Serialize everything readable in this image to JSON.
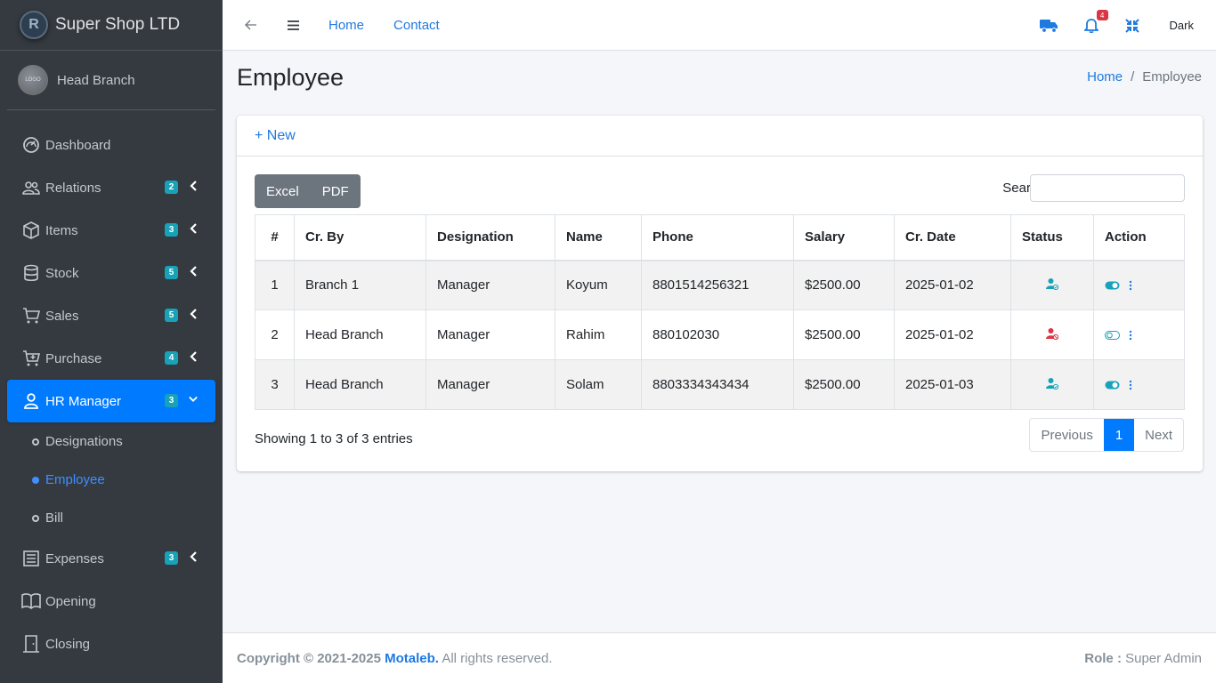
{
  "brand": {
    "name": "Super Shop LTD",
    "logo_letter": "R"
  },
  "user": {
    "name": "Head Branch",
    "avatar_text": "LOGO"
  },
  "sidebar": {
    "items": [
      {
        "label": "Dashboard",
        "icon": "gauge-icon"
      },
      {
        "label": "Relations",
        "icon": "users-icon",
        "badge": "2"
      },
      {
        "label": "Items",
        "icon": "box-icon",
        "badge": "3"
      },
      {
        "label": "Stock",
        "icon": "database-icon",
        "badge": "5"
      },
      {
        "label": "Sales",
        "icon": "cart-icon",
        "badge": "5"
      },
      {
        "label": "Purchase",
        "icon": "cart-plus-icon",
        "badge": "4"
      },
      {
        "label": "HR Manager",
        "icon": "user-icon",
        "badge": "3"
      }
    ],
    "sub_items": [
      "Designations",
      "Employee",
      "Bill"
    ],
    "items_after": [
      {
        "label": "Expenses",
        "icon": "list-icon",
        "badge": "3"
      },
      {
        "label": "Opening",
        "icon": "book-icon"
      },
      {
        "label": "Closing",
        "icon": "door-icon"
      }
    ]
  },
  "topbar": {
    "home": "Home",
    "contact": "Contact",
    "notif_count": "4",
    "theme": "Dark"
  },
  "page": {
    "title": "Employee",
    "breadcrumb_home": "Home",
    "breadcrumb_current": "Employee"
  },
  "card": {
    "new_label": "+ New",
    "excel": "Excel",
    "pdf": "PDF",
    "search_label": "Search:"
  },
  "table": {
    "headers": [
      "#",
      "Cr. By",
      "Designation",
      "Name",
      "Phone",
      "Salary",
      "Cr. Date",
      "Status",
      "Action"
    ],
    "rows": [
      {
        "no": "1",
        "cr_by": "Branch 1",
        "designation": "Manager",
        "name": "Koyum",
        "phone": "8801514256321",
        "salary": "$2500.00",
        "date": "2025-01-02",
        "status": "active",
        "toggle": "on"
      },
      {
        "no": "2",
        "cr_by": "Head Branch",
        "designation": "Manager",
        "name": "Rahim",
        "phone": "880102030",
        "salary": "$2500.00",
        "date": "2025-01-02",
        "status": "inactive",
        "toggle": "off"
      },
      {
        "no": "3",
        "cr_by": "Head Branch",
        "designation": "Manager",
        "name": "Solam",
        "phone": "8803334343434",
        "salary": "$2500.00",
        "date": "2025-01-03",
        "status": "active",
        "toggle": "on"
      }
    ]
  },
  "pagination": {
    "info": "Showing 1 to 3 of 3 entries",
    "previous": "Previous",
    "current": "1",
    "next": "Next"
  },
  "footer": {
    "copyright": "Copyright © 2021-2025",
    "author": "Motaleb.",
    "rights": "All rights reserved.",
    "role_label": "Role :",
    "role_value": "Super Admin"
  },
  "colors": {
    "primary": "#007bff",
    "sidebar": "#343a40",
    "badge": "#17a2b8",
    "active_status": "#17a2b8",
    "inactive_status": "#dc3545"
  }
}
